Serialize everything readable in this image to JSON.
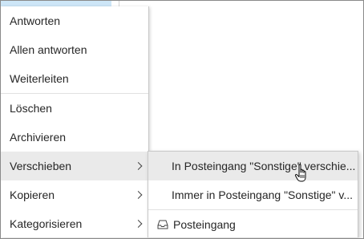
{
  "context_menu": {
    "items": [
      {
        "label": "Antworten"
      },
      {
        "label": "Allen antworten"
      },
      {
        "label": "Weiterleiten"
      },
      {
        "label": "Löschen"
      },
      {
        "label": "Archivieren"
      },
      {
        "label": "Verschieben"
      },
      {
        "label": "Kopieren"
      },
      {
        "label": "Kategorisieren"
      }
    ]
  },
  "submenu": {
    "items": [
      {
        "label": "In Posteingang \"Sonstige\" verschie..."
      },
      {
        "label": "Immer in Posteingang \"Sonstige\" v..."
      },
      {
        "label": "Posteingang",
        "icon": "inbox-icon"
      }
    ]
  },
  "colors": {
    "hover_background": "#eaeaea",
    "selected_row": "#cde6f7",
    "accent": "#2b6cb0"
  }
}
